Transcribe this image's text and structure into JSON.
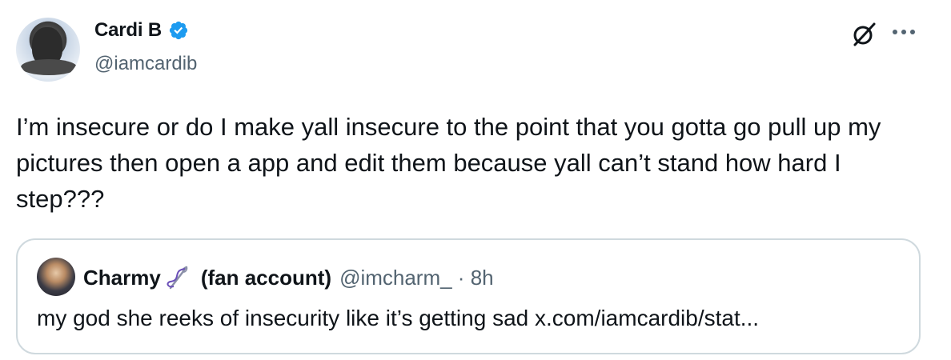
{
  "author": {
    "display_name": "Cardi B",
    "handle": "@iamcardib",
    "verified": true
  },
  "tweet": {
    "text": "I’m insecure or do I make yall insecure to the point that you gotta go pull up my pictures then open a app and edit them because yall can’t stand how hard I step???"
  },
  "quoted_tweet": {
    "display_name": "Charmy",
    "name_suffix": "(fan account)",
    "handle_time": "@imcharm_ · 8h",
    "text": "my god she reeks of insecurity like it’s getting sad x.com/iamcardib/stat..."
  },
  "icons": {
    "verified": "verified-badge-icon",
    "grok": "grok-icon",
    "more": "more-options-icon",
    "quote_emoji": "needle-thread-emoji-icon"
  },
  "colors": {
    "verified_blue": "#1d9bf0",
    "secondary_text": "#536471",
    "border": "#cfd9de"
  }
}
